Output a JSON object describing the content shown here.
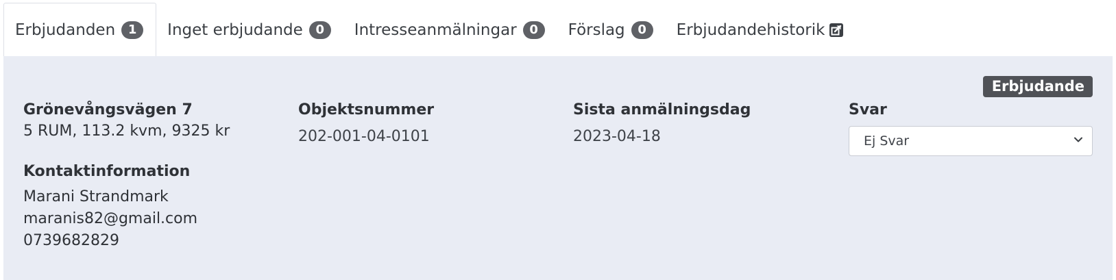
{
  "tabs": [
    {
      "label": "Erbjudanden",
      "count": "1"
    },
    {
      "label": "Inget erbjudande",
      "count": "0"
    },
    {
      "label": "Intresseanmälningar",
      "count": "0"
    },
    {
      "label": "Förslag",
      "count": "0"
    },
    {
      "label": "Erbjudandehistorik",
      "icon": "external-link-icon"
    }
  ],
  "offer": {
    "type_badge": "Erbjudande",
    "address": "Grönevångsvägen 7",
    "details": "5 RUM, 113.2 kvm, 9325 kr",
    "object_number_label": "Objektsnummer",
    "object_number": "202-001-04-0101",
    "deadline_label": "Sista anmälningsdag",
    "deadline": "2023-04-18",
    "reply_label": "Svar",
    "reply_selected": "Ej Svar",
    "contact_label": "Kontaktinformation",
    "contact_name": "Marani Strandmark",
    "contact_email": "maranis82@gmail.com",
    "contact_phone": "0739682829"
  },
  "colors": {
    "panel_bg": "#e9ecf4",
    "badge_bg": "#5f6166",
    "type_badge_bg": "#505257"
  }
}
